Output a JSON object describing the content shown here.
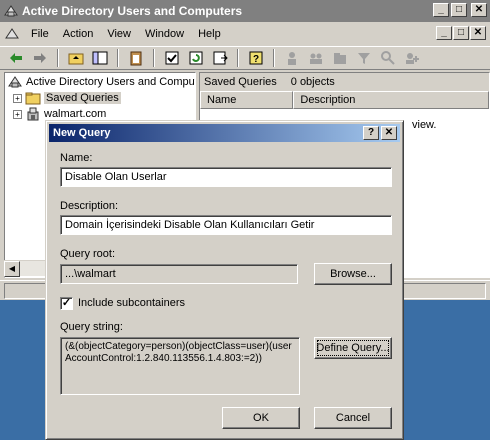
{
  "window": {
    "title": "Active Directory Users and Computers"
  },
  "window_buttons": {
    "minimize": "_",
    "maximize": "□",
    "close": "✕"
  },
  "menu": {
    "items": [
      "File",
      "Action",
      "View",
      "Window",
      "Help"
    ]
  },
  "tree": {
    "root": "Active Directory Users and Computer",
    "items": [
      {
        "label": "Saved Queries",
        "selected": true
      },
      {
        "label": "walmart.com",
        "selected": false
      }
    ]
  },
  "right_pane": {
    "heading": "Saved Queries",
    "count": "0 objects",
    "columns": [
      "Name",
      "Description"
    ],
    "empty_text": "view."
  },
  "dialog": {
    "title": "New Query",
    "help_button": "?",
    "close_button": "✕",
    "name_label": "Name:",
    "name_value": "Disable Olan Userlar",
    "description_label": "Description:",
    "description_value": "Domain İçerisindeki Disable Olan Kullanıcıları Getir",
    "query_root_label": "Query root:",
    "query_root_value": "...\\walmart",
    "browse_button": "Browse...",
    "include_subcontainers_label": "Include subcontainers",
    "include_subcontainers_checked": true,
    "query_string_label": "Query string:",
    "query_string_value": "(&(objectCategory=person)(objectClass=user)(userAccountControl:1.2.840.113556.1.4.803:=2))",
    "define_query_button": "Define Query...",
    "ok_button": "OK",
    "cancel_button": "Cancel"
  },
  "colors": {
    "title_active_start": "#0a246a",
    "title_active_end": "#a6caf0",
    "title_inactive": "#808080",
    "face": "#d4d0c8",
    "desktop": "#3a6ea5"
  }
}
